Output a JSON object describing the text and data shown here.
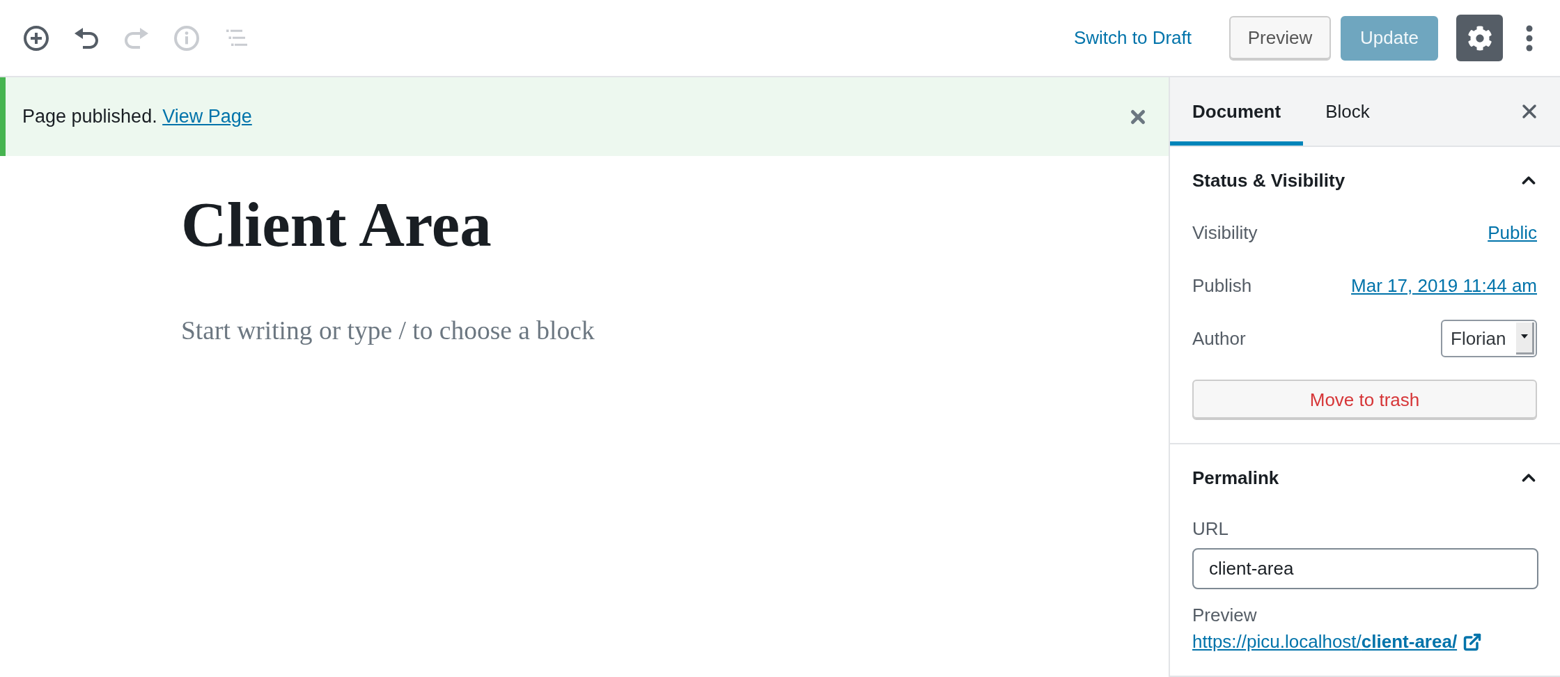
{
  "toolbar": {
    "tools": [
      {
        "kind": "inserter",
        "disabled": false
      },
      {
        "kind": "undo",
        "disabled": false
      },
      {
        "kind": "redo",
        "disabled": true
      },
      {
        "kind": "info",
        "disabled": true
      },
      {
        "kind": "outline",
        "disabled": true
      }
    ],
    "switch_to_draft": "Switch to Draft",
    "preview_button": "Preview",
    "update_button": {
      "label": "Update",
      "disabled": true
    },
    "settings_button": {
      "pressed": true
    }
  },
  "notice": {
    "text": "Page published.",
    "link": "View Page"
  },
  "editor": {
    "title": "Client Area",
    "placeholder": "Start writing or type / to choose a block"
  },
  "sidebar": {
    "tabs": [
      {
        "label": "Document",
        "selected": true
      },
      {
        "label": "Block",
        "selected": false
      }
    ],
    "status_panel": {
      "title": "Status & Visibility",
      "expanded": true,
      "rows": [
        {
          "kind": "link",
          "label": "Visibility",
          "value": "Public"
        },
        {
          "kind": "link",
          "label": "Publish",
          "value": "Mar 17, 2019 11:44 am"
        },
        {
          "kind": "select",
          "label": "Author",
          "value": "Florian"
        }
      ],
      "trash_button": "Move to trash"
    },
    "permalink_panel": {
      "title": "Permalink",
      "expanded": true,
      "url_label": "URL",
      "url_value": "client-area",
      "preview_label": "Preview",
      "preview_link": "https://picu.localhost/**client-area/**"
    }
  }
}
